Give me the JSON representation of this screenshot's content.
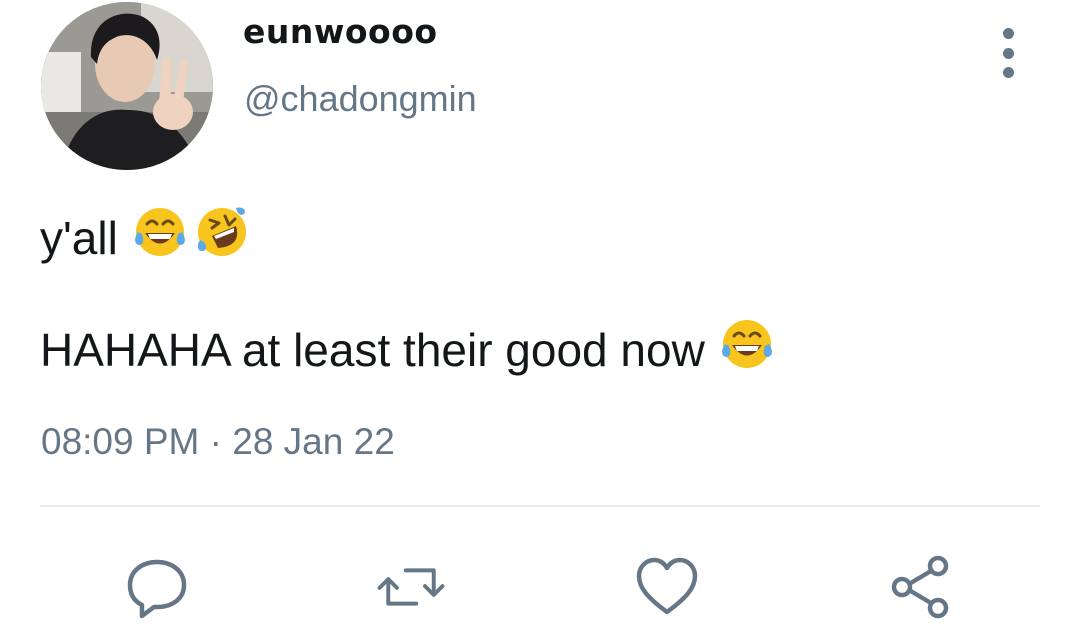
{
  "tweet": {
    "author": {
      "display_name": "eunwoooo",
      "handle": "@chadongmin"
    },
    "lines": [
      {
        "text": "y'all",
        "emojis": [
          "face-with-tears-of-joy",
          "rolling-on-the-floor-laughing"
        ]
      },
      {
        "text": "HAHAHA at least their good now",
        "emojis": [
          "face-with-tears-of-joy"
        ]
      }
    ],
    "timestamp": "08:09 PM · 28 Jan 22",
    "actions": [
      "reply-icon",
      "retweet-icon",
      "like-icon",
      "share-icon"
    ]
  },
  "colors": {
    "text_primary": "#14171a",
    "text_secondary": "#657786",
    "divider": "#e6ecf0",
    "emoji_yellow": "#f7c51e",
    "emoji_tear": "#5fa8e6"
  }
}
